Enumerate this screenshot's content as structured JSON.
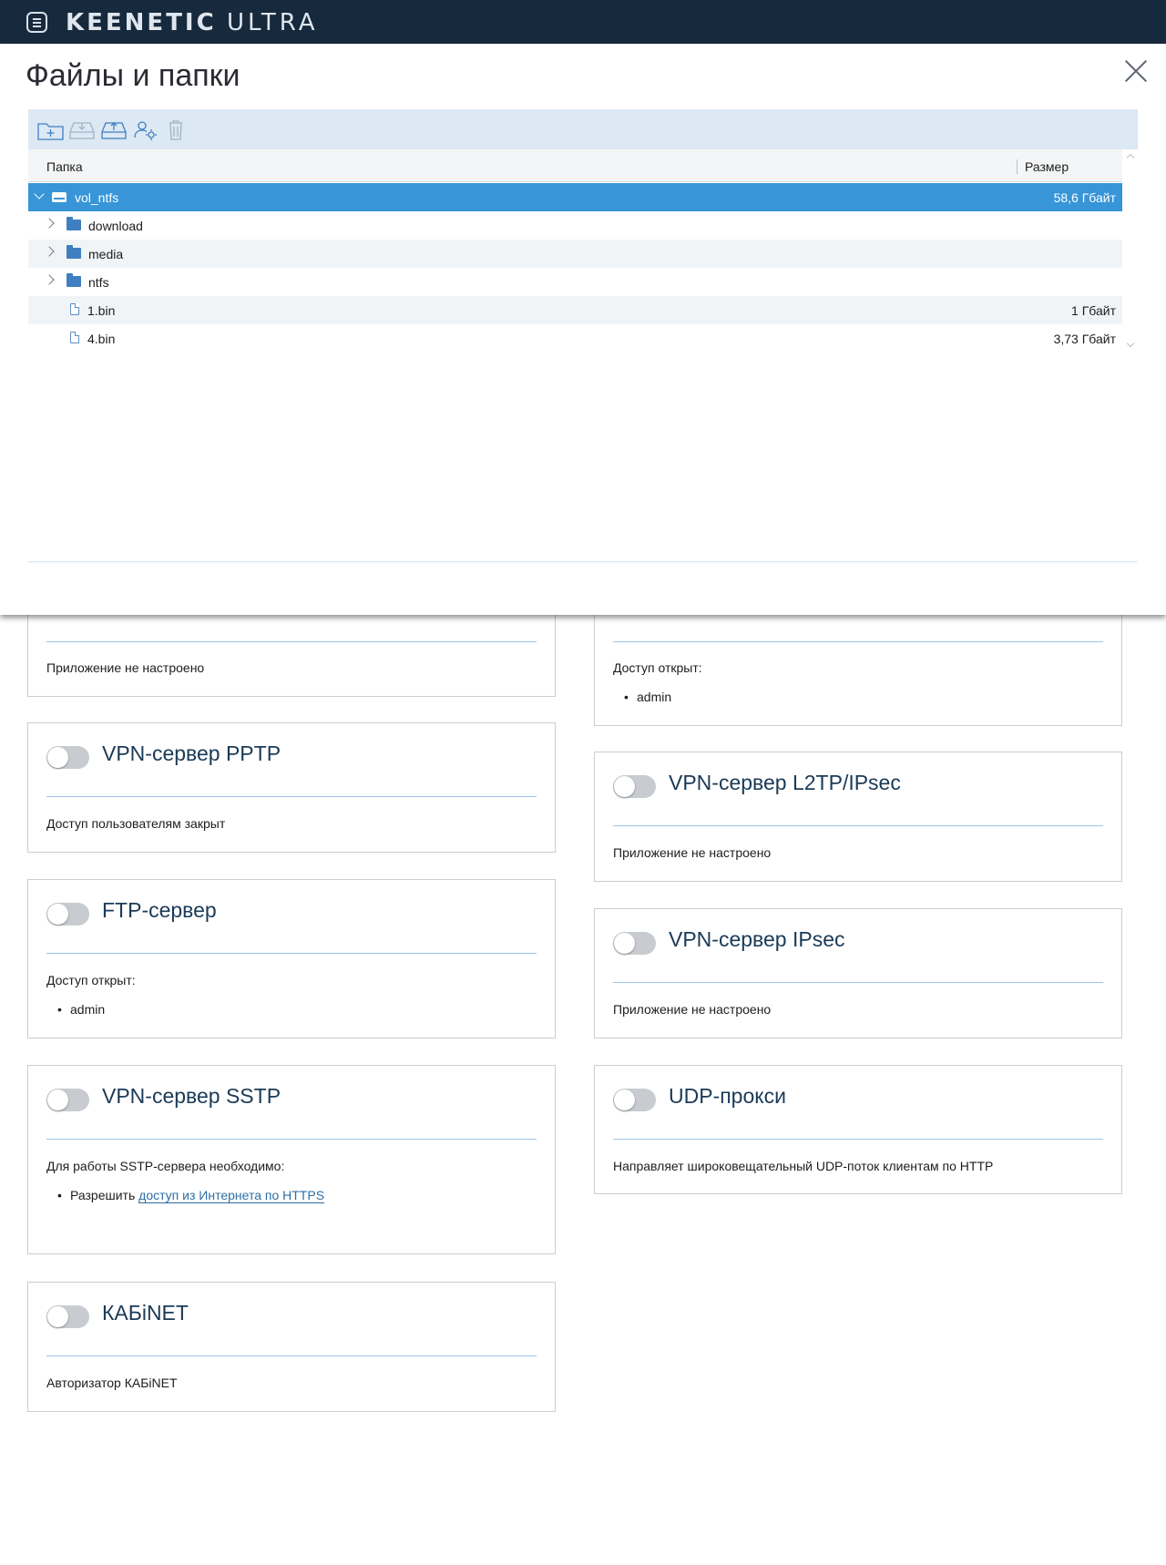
{
  "topbar": {
    "brand": "KEENETIC",
    "model": "ULTRA"
  },
  "modal": {
    "title": "Файлы и папки",
    "toolbar": {
      "icons": [
        "new-folder-icon",
        "download-icon",
        "upload-icon",
        "permissions-icon",
        "delete-icon"
      ]
    },
    "columns": {
      "folder": "Папка",
      "size": "Размер"
    },
    "rows": [
      {
        "name": "vol_ntfs",
        "size": "58,6 Гбайт",
        "type": "drive",
        "expanded": true,
        "selected": true
      },
      {
        "name": "download",
        "size": "",
        "type": "folder"
      },
      {
        "name": "media",
        "size": "",
        "type": "folder"
      },
      {
        "name": "ntfs",
        "size": "",
        "type": "folder"
      },
      {
        "name": "1.bin",
        "size": "1 Гбайт",
        "type": "file"
      },
      {
        "name": "4.bin",
        "size": "3,73 Гбайт",
        "type": "file"
      }
    ]
  },
  "cards": {
    "partial_left": {
      "desc": "Приложение не настроено"
    },
    "partial_right": {
      "desc": "Доступ открыт:",
      "users": [
        "admin"
      ]
    },
    "pptp": {
      "title": "VPN-сервер PPTP",
      "desc": "Доступ пользователям закрыт",
      "enabled": false
    },
    "l2tp": {
      "title": "VPN-сервер L2TP/IPsec",
      "desc": "Приложение не настроено",
      "enabled": false
    },
    "ftp": {
      "title": "FTP-сервер",
      "desc": "Доступ открыт:",
      "users": [
        "admin"
      ],
      "enabled": false
    },
    "ipsec": {
      "title": "VPN-сервер IPsec",
      "desc": "Приложение не настроено",
      "enabled": false
    },
    "sstp": {
      "title": "VPN-сервер SSTP",
      "desc": "Для работы SSTP-сервера необходимо:",
      "item_prefix": "Разрешить",
      "item_link": "доступ из Интернета по HTTPS",
      "enabled": false
    },
    "udp": {
      "title": "UDP-прокси",
      "desc": "Направляет широковещательный UDP-поток клиентам по HTTP",
      "enabled": false
    },
    "kabinet": {
      "title": "КАБiNET",
      "desc": "Авторизатор КАБiNET",
      "enabled": false
    }
  },
  "colors": {
    "topbar": "#17293d",
    "accent": "#3795d8",
    "toolbar": "#dce8f3",
    "card_title": "#1b3a57"
  }
}
